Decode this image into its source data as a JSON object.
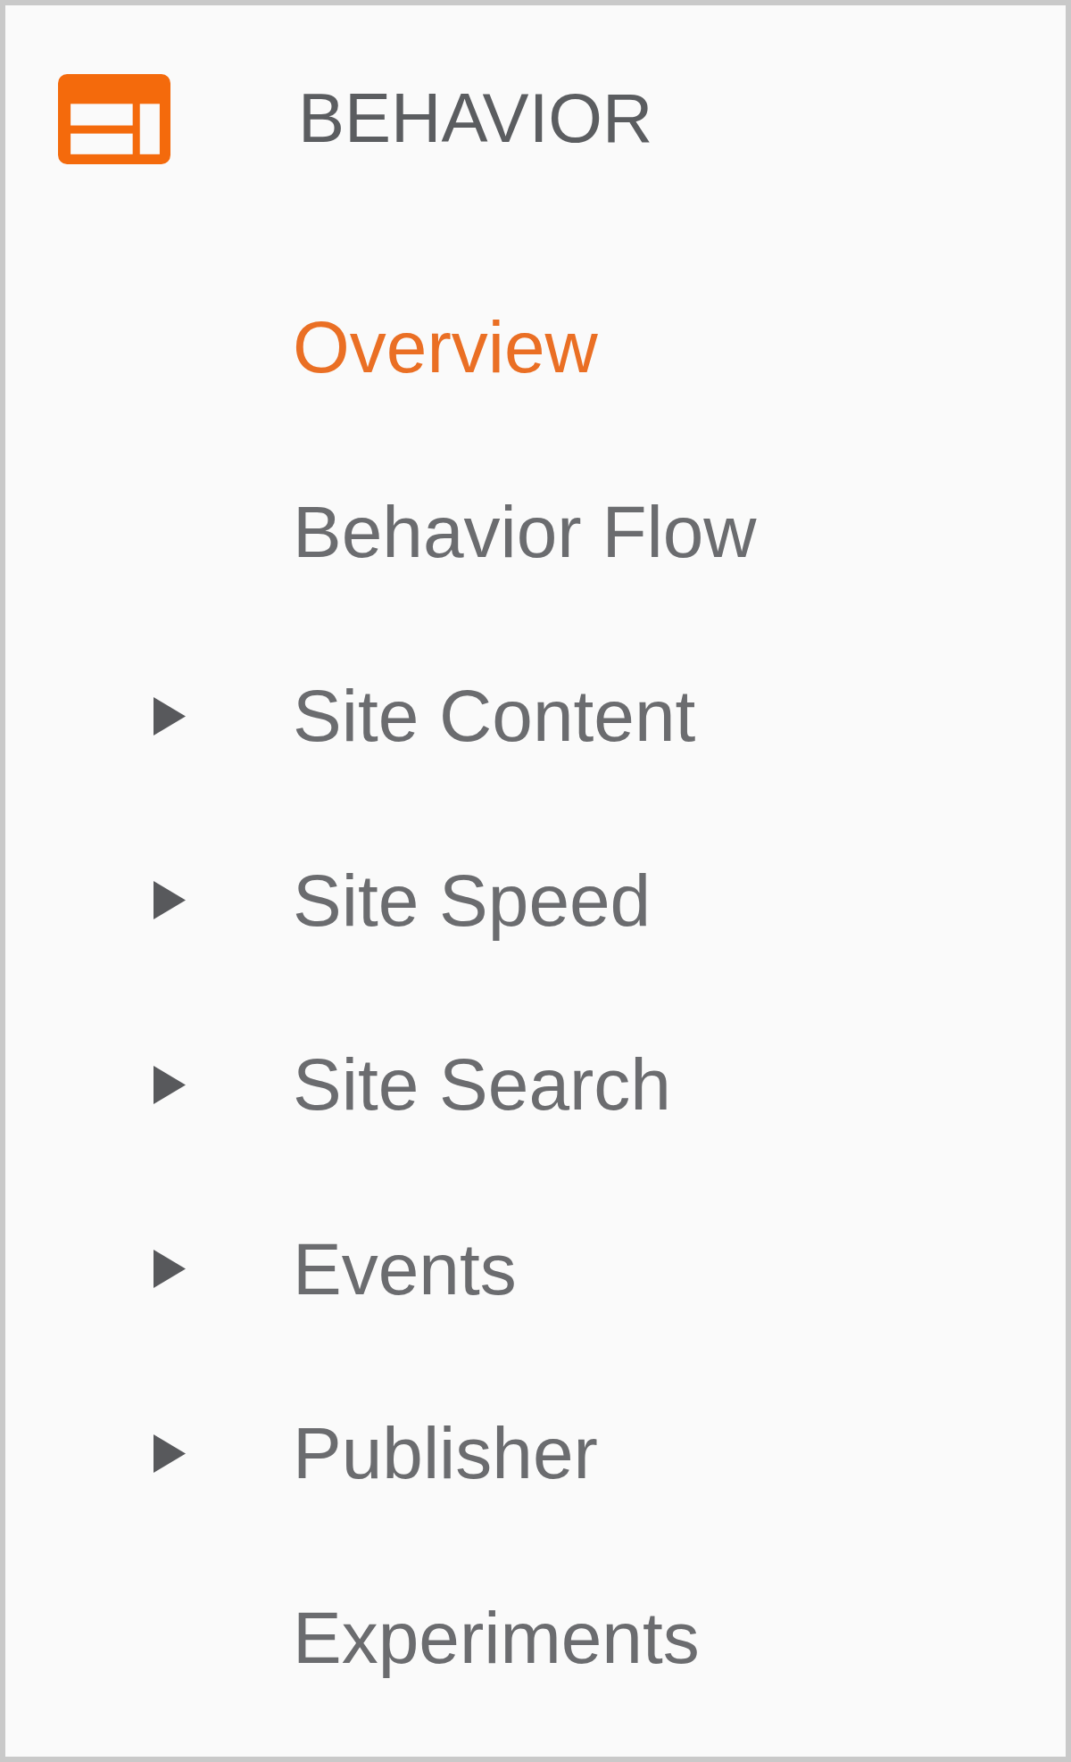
{
  "section": {
    "title": "BEHAVIOR"
  },
  "items": [
    {
      "label": "Overview",
      "kind": "link",
      "selected": true
    },
    {
      "label": "Behavior Flow",
      "kind": "link",
      "selected": false
    },
    {
      "label": "Site Content",
      "kind": "group",
      "selected": false
    },
    {
      "label": "Site Speed",
      "kind": "group",
      "selected": false
    },
    {
      "label": "Site Search",
      "kind": "group",
      "selected": false
    },
    {
      "label": "Events",
      "kind": "group",
      "selected": false
    },
    {
      "label": "Publisher",
      "kind": "group",
      "selected": false
    },
    {
      "label": "Experiments",
      "kind": "link",
      "selected": false
    }
  ]
}
